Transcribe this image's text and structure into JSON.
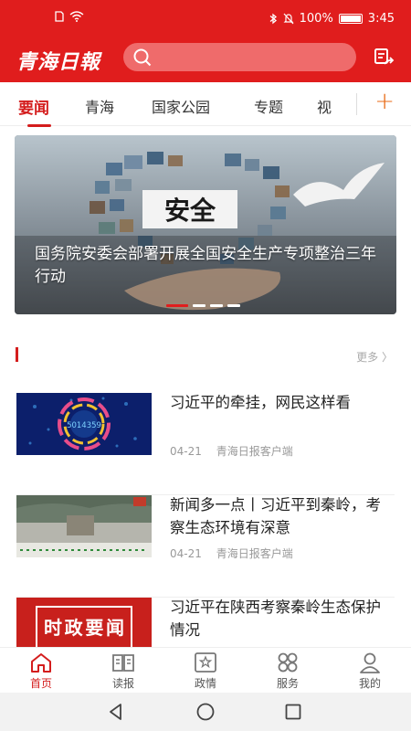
{
  "status_bar": {
    "battery_label": "100%",
    "battery_level": 1.0,
    "time": "3:45"
  },
  "header": {
    "logo_text": "青海日報",
    "search": {
      "placeholder": ""
    }
  },
  "tabs": [
    "要闻",
    "青海",
    "国家公园",
    "专题",
    "视"
  ],
  "tab_active_index": 0,
  "banner": {
    "title": "国务院安委会部署开展全国安全生产专项整治三年行动",
    "image_text": "安全",
    "slide_count": 4,
    "active_slide": 0
  },
  "section": {
    "more_label": "更多 〉"
  },
  "news": [
    {
      "title": "习近平的牵挂，网民这样看",
      "date": "04-21",
      "source": "青海日报客户端",
      "thumb_text": "5014359"
    },
    {
      "title": "新闻多一点丨习近平到秦岭，考察生态环境有深意",
      "date": "04-21",
      "source": "青海日报客户端",
      "thumb_text": ""
    },
    {
      "title": "习近平在陕西考察秦岭生态保护情况",
      "date": "",
      "source": "",
      "thumb_text": "时政要闻"
    }
  ],
  "bottom_nav": [
    {
      "label": "首页",
      "icon": "home-icon",
      "active": true
    },
    {
      "label": "读报",
      "icon": "book-icon",
      "active": false
    },
    {
      "label": "政情",
      "icon": "emblem-icon",
      "active": false
    },
    {
      "label": "服务",
      "icon": "grid-icon",
      "active": false
    },
    {
      "label": "我的",
      "icon": "user-icon",
      "active": false
    }
  ],
  "colors": {
    "brand_red": "#e01d1d",
    "accent_orange": "#e86a14"
  }
}
